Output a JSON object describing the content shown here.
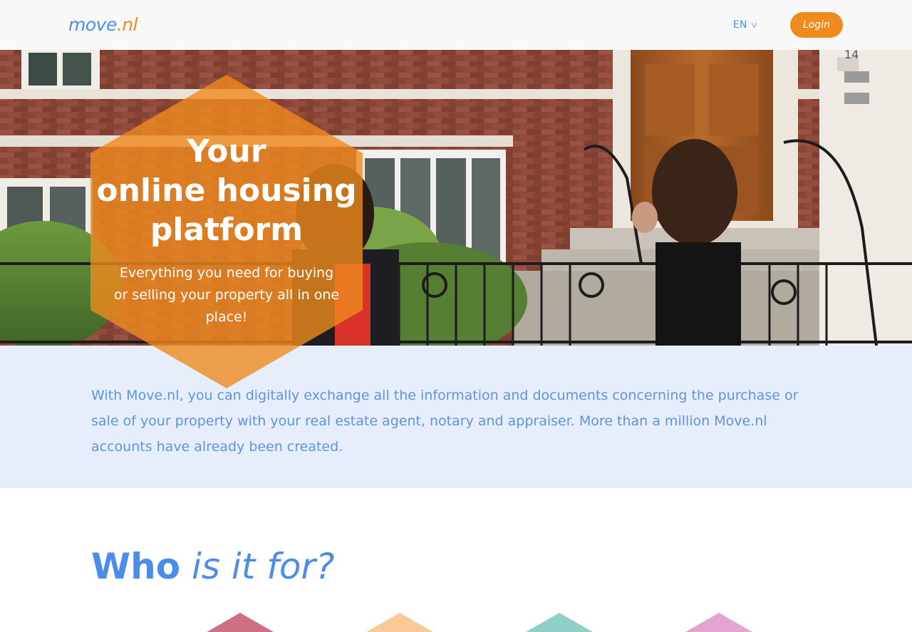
{
  "header": {
    "logo_move": "move",
    "logo_nl": ".nl",
    "language": "EN",
    "login_label": "Login"
  },
  "hero": {
    "title_line1": "Your",
    "title_line2": "online housing",
    "title_line3": "platform",
    "subtitle": "Everything you need for buying or selling your property all in one place!",
    "house_number": "14"
  },
  "intro": {
    "text": "With Move.nl, you can digitally exchange all the information and documents concerning the purchase or sale of your property with your real estate agent, notary and appraiser. More than a million Move.nl accounts have already been created."
  },
  "who": {
    "word1": "Who",
    "word2": "is it for?"
  },
  "colors": {
    "brand_blue": "#4a8ee8",
    "brand_orange": "#ef8a1e",
    "band_bg": "#e6eefb",
    "card_colors": [
      "#cf6f82",
      "#f9c99a",
      "#8fcfc6",
      "#e3a5cf"
    ]
  },
  "icons": {
    "language_chevron": "chevron-down-icon"
  }
}
